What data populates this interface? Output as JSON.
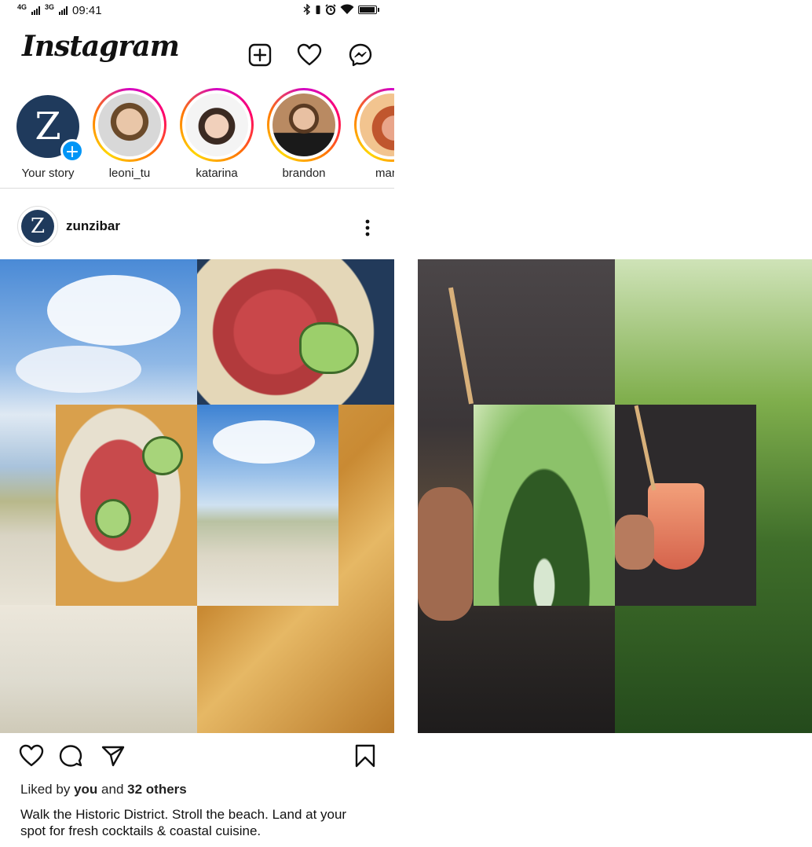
{
  "status_bar": {
    "net1": "4G",
    "net2": "3G",
    "time": "09:41",
    "icons": [
      "bluetooth-icon",
      "alarm-icon",
      "wifi-icon",
      "battery-icon"
    ]
  },
  "header": {
    "logo": "Instagram",
    "icons": [
      "new-post-icon",
      "heart-icon",
      "messenger-icon"
    ]
  },
  "stories": [
    {
      "label": "Your story",
      "own": true
    },
    {
      "label": "leoni_tu"
    },
    {
      "label": "katarina"
    },
    {
      "label": "brandon"
    },
    {
      "label": "manis"
    }
  ],
  "post": {
    "username": "zunzibar",
    "avatar_letter": "Z",
    "likes": {
      "prefix": "Liked by",
      "user": "you",
      "joiner": "and",
      "others": "32 others"
    },
    "caption": "Walk the Historic District. Stroll the beach. Land at your spot for fresh cocktails & coastal cuisine."
  },
  "colors": {
    "brand_navy": "#1f3a5c",
    "story_blue": "#0095f6",
    "story_ring": "#ff0069"
  }
}
